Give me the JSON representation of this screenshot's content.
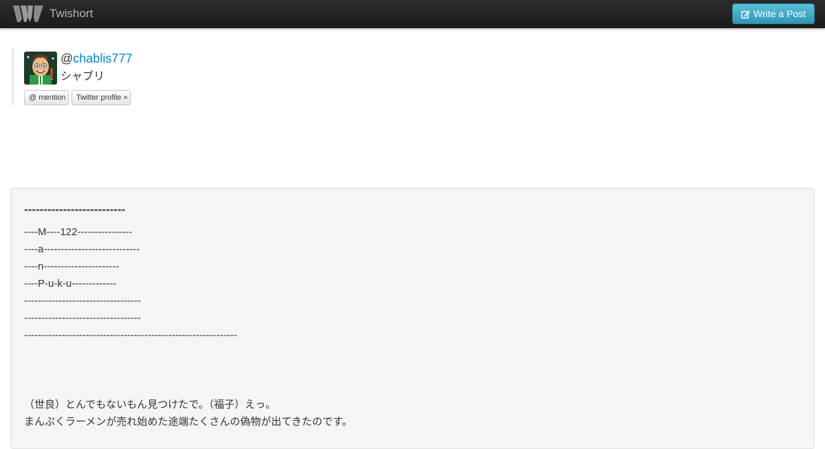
{
  "navbar": {
    "brand": "Twishort",
    "write_button": "Write a Post"
  },
  "profile": {
    "at": "@",
    "username": "chablis777",
    "display_name": "シャブリ",
    "mention_button": "@ mention",
    "profile_button": "Twitter profile »"
  },
  "post": {
    "title": "--------------------------",
    "lines": [
      "----M----122----------------",
      "----a----------------------------",
      "----n----------------------",
      "----P-u-k-u-------------",
      "----------------------------------",
      "----------------------------------",
      "--------------------------------------------------------------",
      "",
      "",
      "",
      "（世良）とんでもないもん見つけたで。（福子）えっ。",
      "まんぷくラーメンが売れ始めた途端たくさんの偽物が出てきたのです。"
    ]
  },
  "colors": {
    "navbar": "#222222",
    "button_accent": "#49afcd",
    "link": "#0088cc",
    "post_background": "#f5f5f5"
  },
  "icons": [
    "twishort-logo-icon",
    "edit-icon",
    "avatar"
  ]
}
